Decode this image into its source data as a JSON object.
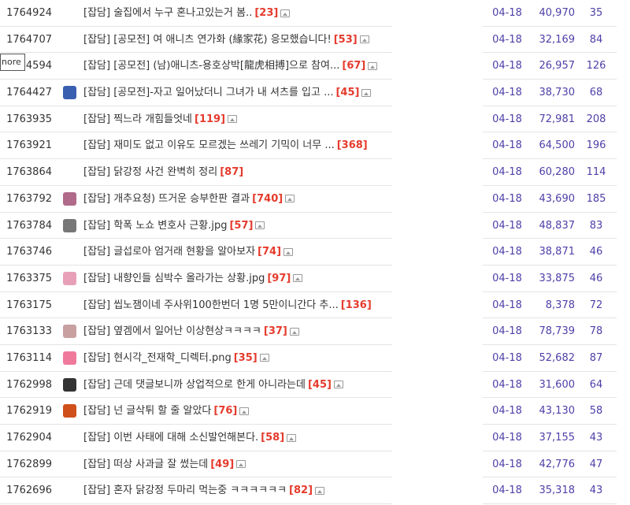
{
  "tooltip": "nore",
  "rows": [
    {
      "id": "1764924",
      "avatar": "",
      "title": "[잡담] 술집에서 누구 혼나고있는거 봄..",
      "comments": "[23]",
      "img": true,
      "date": "04-18",
      "views": "40,970",
      "recommend": "35"
    },
    {
      "id": "1764707",
      "avatar": "",
      "title": "[잡담] [공모전] 여 애니츠 연가화 (緣家花) 응모했습니다!",
      "comments": "[53]",
      "img": true,
      "date": "04-18",
      "views": "32,169",
      "recommend": "84"
    },
    {
      "id": "1764594",
      "avatar": "",
      "title": "[잡담] [공모전] (남)애니츠-용호상박[龍虎相搏]으로 참여...",
      "comments": "[67]",
      "img": true,
      "date": "04-18",
      "views": "26,957",
      "recommend": "126"
    },
    {
      "id": "1764427",
      "avatar": "#3a5fb0",
      "title": "[잡담] [공모전]-자고 일어났더니 그녀가 내 셔츠를 입고 ...",
      "comments": "[45]",
      "img": true,
      "date": "04-18",
      "views": "38,730",
      "recommend": "68"
    },
    {
      "id": "1763935",
      "avatar": "",
      "title": "[잡담] 찍느라 개힘들엇네",
      "comments": "[119]",
      "img": true,
      "date": "04-18",
      "views": "72,981",
      "recommend": "208"
    },
    {
      "id": "1763921",
      "avatar": "",
      "title": "[잡담] 재미도 없고 이유도 모르겠는 쓰레기 기믹이 너무 ...",
      "comments": "[368]",
      "img": false,
      "date": "04-18",
      "views": "64,500",
      "recommend": "196"
    },
    {
      "id": "1763864",
      "avatar": "",
      "title": "[잡담] 닭강정 사건 완벽히 정리",
      "comments": "[87]",
      "img": false,
      "date": "04-18",
      "views": "60,280",
      "recommend": "114"
    },
    {
      "id": "1763792",
      "avatar": "#b06a8a",
      "title": "[잡담] 개추요청) 뜨거운 승부한판 결과",
      "comments": "[740]",
      "img": true,
      "date": "04-18",
      "views": "43,690",
      "recommend": "185"
    },
    {
      "id": "1763784",
      "avatar": "#777777",
      "title": "[잡담] 학폭 노쇼 변호사 근황.jpg",
      "comments": "[57]",
      "img": true,
      "date": "04-18",
      "views": "48,837",
      "recommend": "83"
    },
    {
      "id": "1763746",
      "avatar": "",
      "title": "[잡담] 글섭로아 엄거래 현황을 알아보자",
      "comments": "[74]",
      "img": true,
      "date": "04-18",
      "views": "38,871",
      "recommend": "46"
    },
    {
      "id": "1763375",
      "avatar": "#e8a0b8",
      "title": "[잡담] 내향인들 심박수 올라가는 상황.jpg",
      "comments": "[97]",
      "img": true,
      "date": "04-18",
      "views": "33,875",
      "recommend": "46"
    },
    {
      "id": "1763175",
      "avatar": "",
      "title": "[잡담] 씹노잼이네 주사위100한번더 1명 5만이니간다 추...",
      "comments": "[136]",
      "img": false,
      "date": "04-18",
      "views": "8,378",
      "recommend": "72"
    },
    {
      "id": "1763133",
      "avatar": "#c9a0a0",
      "title": "[잡담] 옆겜에서 일어난 이상현상ㅋㅋㅋㅋ",
      "comments": "[37]",
      "img": true,
      "date": "04-18",
      "views": "78,739",
      "recommend": "78"
    },
    {
      "id": "1763114",
      "avatar": "#f07a9c",
      "title": "[잡담] 현시각_전재학_디렉터.png",
      "comments": "[35]",
      "img": true,
      "date": "04-18",
      "views": "52,682",
      "recommend": "87"
    },
    {
      "id": "1762998",
      "avatar": "#333333",
      "title": "[잡담] 근데 댓글보니까 상업적으로 한게 아니라는데",
      "comments": "[45]",
      "img": true,
      "date": "04-18",
      "views": "31,600",
      "recommend": "64"
    },
    {
      "id": "1762919",
      "avatar": "#d0501c",
      "title": "[잡담] 넌 글삭튀 할 줄 알았다",
      "comments": "[76]",
      "img": true,
      "date": "04-18",
      "views": "43,130",
      "recommend": "58"
    },
    {
      "id": "1762904",
      "avatar": "",
      "title": "[잡담] 이번 사태에 대해 소신발언해본다.",
      "comments": "[58]",
      "img": true,
      "date": "04-18",
      "views": "37,155",
      "recommend": "43"
    },
    {
      "id": "1762899",
      "avatar": "",
      "title": "[잡담] 떠상 사과글 잘 썼는데",
      "comments": "[49]",
      "img": true,
      "date": "04-18",
      "views": "42,776",
      "recommend": "47"
    },
    {
      "id": "1762696",
      "avatar": "",
      "title": "[잡담] 혼자 닭강정 두마리 먹는중 ㅋㅋㅋㅋㅋㅋ",
      "comments": "[82]",
      "img": true,
      "date": "04-18",
      "views": "35,318",
      "recommend": "43"
    }
  ]
}
